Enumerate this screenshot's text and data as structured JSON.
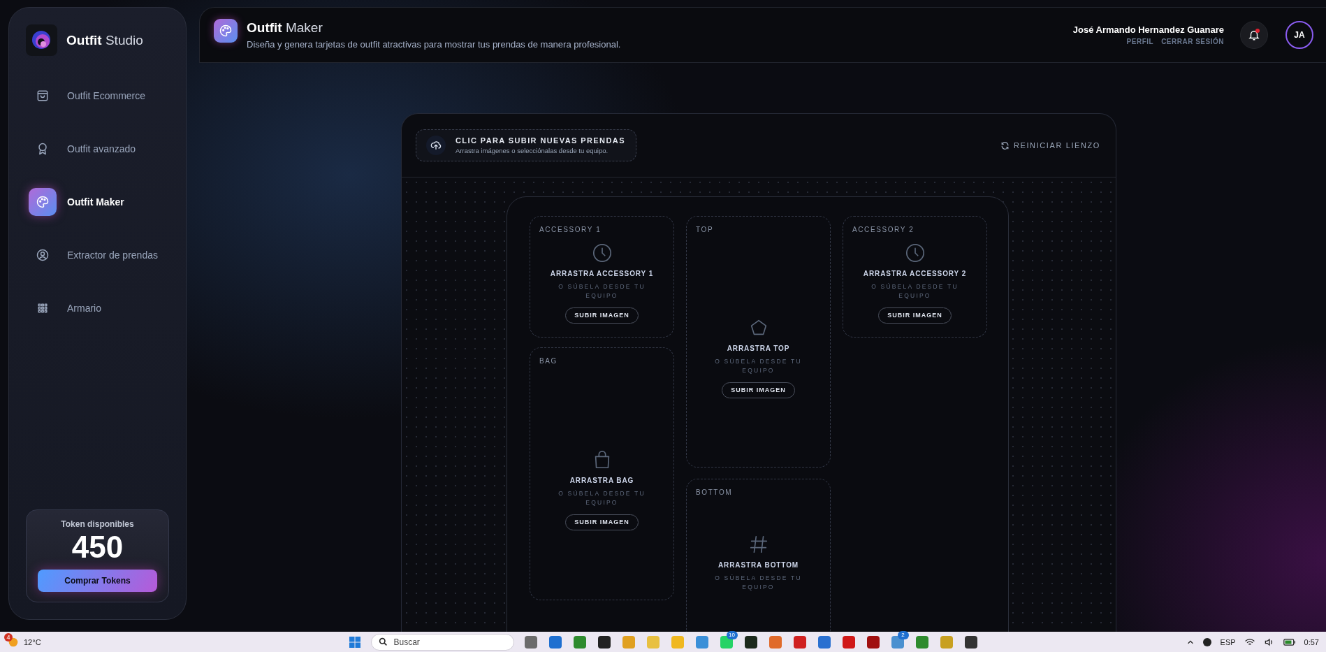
{
  "brand": {
    "name_bold": "Outfit",
    "name_light": "Studio"
  },
  "sidebar": {
    "items": [
      {
        "label": "Outfit Ecommerce",
        "kind": "cart",
        "selected": false
      },
      {
        "label": "Outfit avanzado",
        "kind": "award",
        "selected": false
      },
      {
        "label": "Outfit Maker",
        "kind": "palette",
        "selected": true
      },
      {
        "label": "Extractor de prendas",
        "kind": "user",
        "selected": false
      },
      {
        "label": "Armario",
        "kind": "grid",
        "selected": false
      }
    ]
  },
  "tokens": {
    "label": "Token disponibles",
    "value": "450",
    "button": "Comprar Tokens"
  },
  "header": {
    "title_bold": "Outfit",
    "title_light": "Maker",
    "subtitle": "Diseña y genera tarjetas de outfit atractivas para mostrar tus prendas de manera profesional.",
    "user_name": "José Armando Hernandez Guanare",
    "links": [
      "PERFIL",
      "CERRAR SESIÓN"
    ],
    "notification": true,
    "avatar": "JA"
  },
  "upload": {
    "title": "CLIC PARA SUBIR NUEVAS PRENDAS",
    "subtitle": "Arrastra imágenes o selecciónalas desde tu equipo."
  },
  "reset": "REINICIAR LIENZO",
  "slots": [
    {
      "kind": "clock",
      "label": "ACCESSORY 1",
      "title": "ARRASTRA ACCESSORY 1",
      "hint": "O SÚBELA DESDE TU EQUIPO",
      "button": "SUBIR IMAGEN"
    },
    {
      "kind": "pentagon",
      "label": "TOP",
      "title": "ARRASTRA TOP",
      "hint": "O SÚBELA DESDE TU EQUIPO",
      "button": "SUBIR IMAGEN"
    },
    {
      "kind": "clock",
      "label": "ACCESSORY 2",
      "title": "ARRASTRA ACCESSORY 2",
      "hint": "O SÚBELA DESDE TU EQUIPO",
      "button": "SUBIR IMAGEN"
    },
    {
      "kind": "bag",
      "label": "BAG",
      "title": "ARRASTRA BAG",
      "hint": "O SÚBELA DESDE TU EQUIPO",
      "button": "SUBIR IMAGEN"
    },
    {
      "kind": "hash",
      "label": "BOTTOM",
      "title": "ARRASTRA BOTTOM",
      "hint": "O SÚBELA DESDE TU EQUIPO"
    }
  ],
  "taskbar": {
    "weather_badge": "4",
    "temperature": "12°C",
    "search": "Buscar",
    "app_badges": [
      "10",
      "2"
    ],
    "language": "ESP",
    "time": "0:57"
  }
}
